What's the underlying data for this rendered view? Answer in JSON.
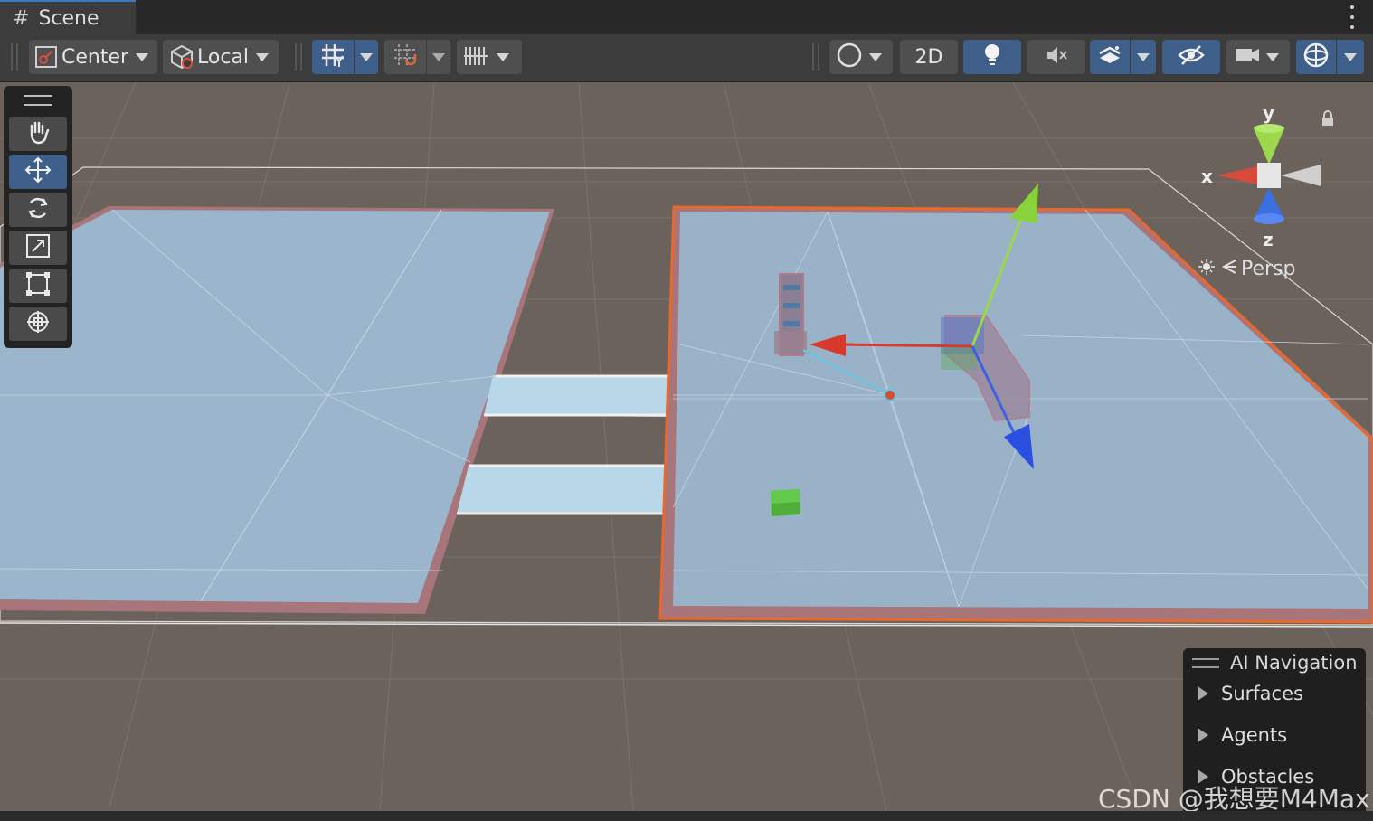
{
  "window": {
    "tab_title": "Scene",
    "tab_icon": "scene-hash-icon",
    "menu_icon": "more-vertical-icon"
  },
  "toolbar": {
    "pivot_label": "Center",
    "space_label": "Local",
    "grid_snap_icon": "grid-visibility-icon",
    "snap_icon": "snap-increment-icon",
    "ruler_icon": "grid-ruler-icon",
    "shading_icon": "shading-mode-icon",
    "mode_2d_label": "2D",
    "lighting_icon": "lightbulb-icon",
    "audio_icon": "audio-mute-icon",
    "effects_icon": "effects-icon",
    "hidden_icon": "visibility-hidden-icon",
    "camera_icon": "camera-icon",
    "gizmos_icon": "gizmos-sphere-icon"
  },
  "tools": {
    "items": [
      "hand-tool",
      "move-tool",
      "rotate-tool",
      "scale-tool",
      "rect-tool",
      "transform-tool"
    ],
    "active": "move-tool"
  },
  "gizmo": {
    "axis_y": "y",
    "axis_x": "x",
    "axis_z": "z",
    "projection_label": "Persp",
    "colors": {
      "x": "#d84a3a",
      "y": "#9bd84c",
      "z": "#3b6fe0"
    }
  },
  "ai_navigation": {
    "title": "AI Navigation",
    "items": [
      "Surfaces",
      "Agents",
      "Obstacles"
    ]
  },
  "watermark": "CSDN @我想要M4Max",
  "colors": {
    "accent": "#3e5f8a",
    "navmesh": "#9bb6cc",
    "selection_outline": "#e8692d",
    "ground": "#6b625b"
  }
}
